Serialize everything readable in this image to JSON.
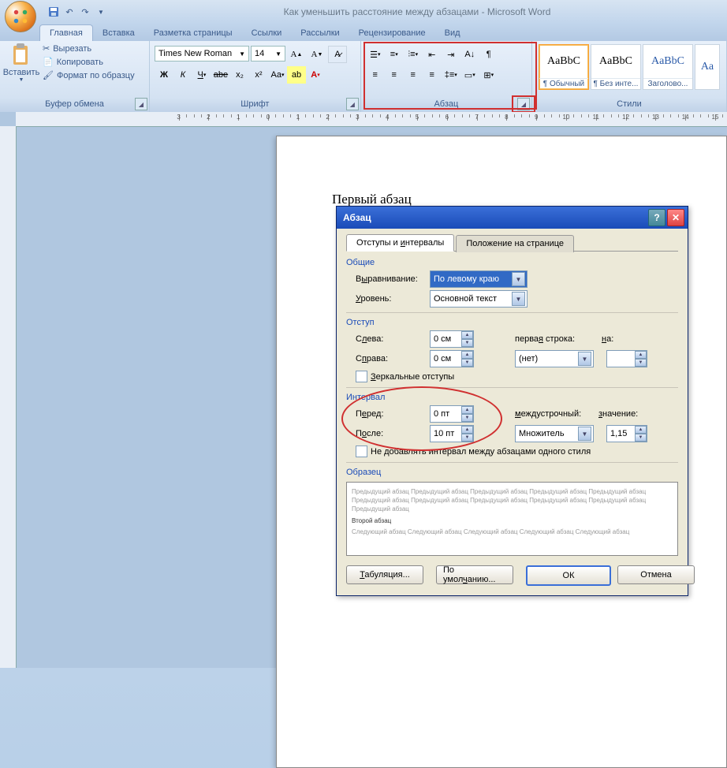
{
  "window_title": "Как уменьшить расстояние между абзацами - Microsoft Word",
  "tabs": [
    "Главная",
    "Вставка",
    "Разметка страницы",
    "Ссылки",
    "Рассылки",
    "Рецензирование",
    "Вид"
  ],
  "clipboard": {
    "title": "Буфер обмена",
    "paste": "Вставить",
    "cut": "Вырезать",
    "copy": "Копировать",
    "format_painter": "Формат по образцу"
  },
  "font": {
    "title": "Шрифт",
    "name": "Times New Roman",
    "size": "14"
  },
  "paragraph": {
    "title": "Абзац"
  },
  "styles_title": "Стили",
  "styles": [
    {
      "preview": "AaBbC",
      "name": "¶ Обычный"
    },
    {
      "preview": "AaBbC",
      "name": "¶ Без инте..."
    },
    {
      "preview": "AaBbC",
      "name": "Заголово..."
    },
    {
      "preview": "Aa",
      "name": ""
    }
  ],
  "page_text": "Первый абзац",
  "dialog": {
    "title": "Абзац",
    "tab1": "Отступы и интервалы",
    "tab2": "Положение на странице",
    "general_title": "Общие",
    "align_label": "Выравнивание:",
    "align_value": "По левому краю",
    "level_label": "Уровень:",
    "level_value": "Основной текст",
    "indent_title": "Отступ",
    "left_label": "Слева:",
    "left_value": "0 см",
    "right_label": "Справа:",
    "right_value": "0 см",
    "firstline_label": "первая строка:",
    "firstline_value": "(нет)",
    "by_label": "на:",
    "by_value": "",
    "mirror_check": "Зеркальные отступы",
    "spacing_title": "Интервал",
    "before_label": "Перед:",
    "before_value": "0 пт",
    "after_label": "После:",
    "after_value": "10 пт",
    "line_label": "междустрочный:",
    "line_value": "Множитель",
    "value_label": "значение:",
    "value_value": "1,15",
    "nosame_check": "Не добавлять интервал между абзацами одного стиля",
    "sample_title": "Образец",
    "sample_prev": "Предыдущий абзац Предыдущий абзац Предыдущий абзац Предыдущий абзац Предыдущий абзац Предыдущий абзац Предыдущий абзац Предыдущий абзац Предыдущий абзац Предыдущий абзац Предыдущий абзац",
    "sample_cur": "Второй абзац",
    "sample_next": "Следующий абзац Следующий абзац Следующий абзац Следующий абзац Следующий абзац",
    "btn_tab": "Табуляция...",
    "btn_default": "По умолчанию...",
    "btn_ok": "ОК",
    "btn_cancel": "Отмена"
  }
}
